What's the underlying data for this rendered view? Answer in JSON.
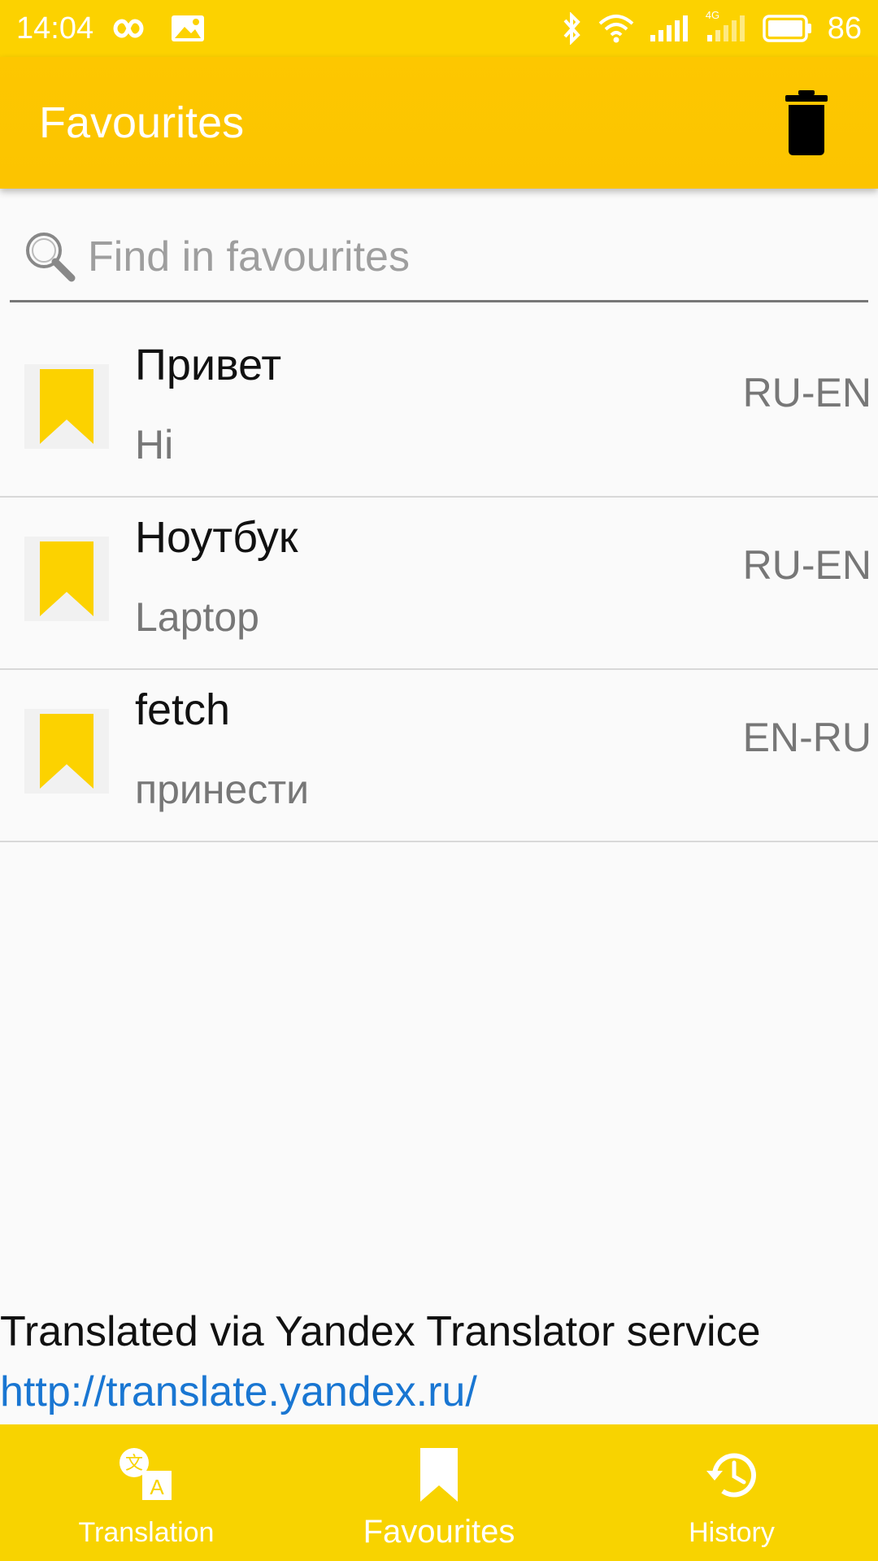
{
  "status_bar": {
    "time": "14:04",
    "battery": "86",
    "network_label": "4G",
    "icons": [
      "infinity-icon",
      "image-icon",
      "bluetooth-icon",
      "wifi-icon",
      "signal-icon",
      "signal-4g-icon",
      "battery-icon"
    ]
  },
  "app_bar": {
    "title": "Favourites",
    "delete_icon": "trash-icon"
  },
  "search": {
    "placeholder": "Find in favourites",
    "value": "",
    "icon": "search-icon"
  },
  "favourites": [
    {
      "word": "Привет",
      "translation": "Hi",
      "lang": "RU-EN"
    },
    {
      "word": "Ноутбук",
      "translation": "Laptop",
      "lang": "RU-EN"
    },
    {
      "word": "fetch",
      "translation": "принести",
      "lang": "EN-RU"
    }
  ],
  "attribution": {
    "text": "Translated via Yandex Translator service",
    "link": "http://translate.yandex.ru/"
  },
  "bottom_nav": {
    "items": [
      {
        "label": "Translation",
        "icon": "translate-icon"
      },
      {
        "label": "Favourites",
        "icon": "bookmark-icon",
        "active": true
      },
      {
        "label": "History",
        "icon": "history-icon"
      }
    ]
  },
  "colors": {
    "accent": "#fcd200",
    "link": "#1976d2",
    "bookmark": "#fcd200"
  }
}
